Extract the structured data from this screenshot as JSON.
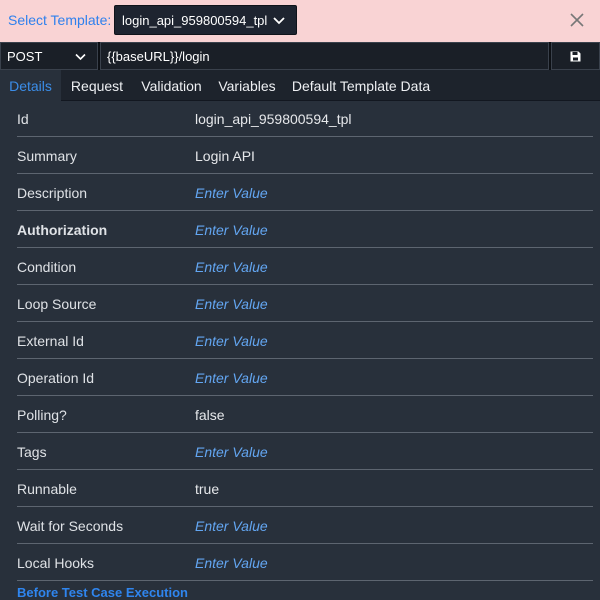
{
  "header": {
    "select_label": "Select Template:",
    "template_value": "login_api_959800594_tpl"
  },
  "request": {
    "method": "POST",
    "url": "{{baseURL}}/login"
  },
  "tabs": [
    {
      "label": "Details",
      "active": true
    },
    {
      "label": "Request",
      "active": false
    },
    {
      "label": "Validation",
      "active": false
    },
    {
      "label": "Variables",
      "active": false
    },
    {
      "label": "Default Template Data",
      "active": false
    }
  ],
  "details": [
    {
      "key": "Id",
      "value": "login_api_959800594_tpl"
    },
    {
      "key": "Summary",
      "value": "Login API"
    },
    {
      "key": "Description",
      "value": "Enter Value"
    },
    {
      "key": "Authorization",
      "value": "Enter Value"
    },
    {
      "key": "Condition",
      "value": "Enter Value"
    },
    {
      "key": "Loop Source",
      "value": "Enter Value"
    },
    {
      "key": "External Id",
      "value": "Enter Value"
    },
    {
      "key": "Operation Id",
      "value": "Enter Value"
    },
    {
      "key": "Polling?",
      "value": "false"
    },
    {
      "key": "Tags",
      "value": "Enter Value"
    },
    {
      "key": "Runnable",
      "value": "true"
    },
    {
      "key": "Wait for Seconds",
      "value": "Enter Value"
    },
    {
      "key": "Local Hooks",
      "value": "Enter Value"
    }
  ],
  "section_link": "Before Test Case Execution",
  "colors": {
    "header_bg": "#f9d3d4",
    "accent": "#2f80ed",
    "placeholder": "#63a6f2",
    "panel_bg": "#28303b"
  }
}
